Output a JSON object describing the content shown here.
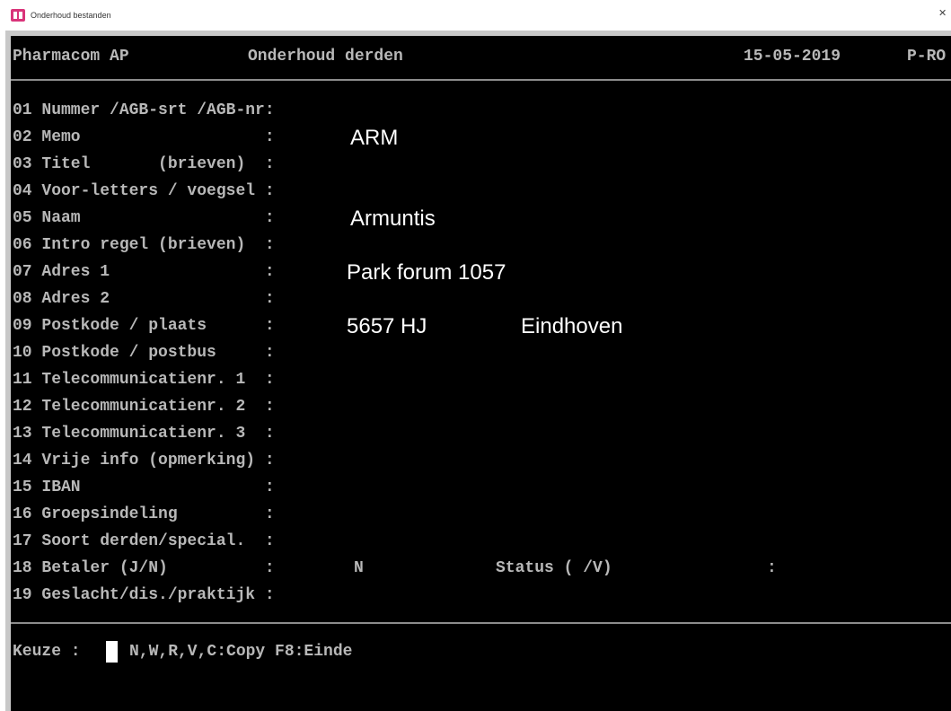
{
  "window": {
    "title": "Onderhoud bestanden",
    "close_symbol": "✕"
  },
  "header": {
    "app": "Pharmacom AP",
    "screen": "Onderhoud derden",
    "date": "15-05-2019",
    "code": "P-RO"
  },
  "fields": [
    {
      "label": "01 Nummer /AGB-srt /AGB-nr:",
      "value": ""
    },
    {
      "label": "02 Memo                   :",
      "value": "ARM"
    },
    {
      "label": "03 Titel       (brieven)  :",
      "value": ""
    },
    {
      "label": "04 Voor-letters / voegsel :",
      "value": ""
    },
    {
      "label": "05 Naam                   :",
      "value": "Armuntis"
    },
    {
      "label": "06 Intro regel (brieven)  :",
      "value": ""
    },
    {
      "label": "07 Adres 1                :",
      "value": "Park forum 1057"
    },
    {
      "label": "08 Adres 2                :",
      "value": ""
    },
    {
      "label": "09 Postkode / plaats      :",
      "value": "5657 HJ",
      "value2": "Eindhoven"
    },
    {
      "label": "10 Postkode / postbus     :",
      "value": ""
    },
    {
      "label": "11 Telecommunicatienr. 1  :",
      "value": ""
    },
    {
      "label": "12 Telecommunicatienr. 2  :",
      "value": ""
    },
    {
      "label": "13 Telecommunicatienr. 3  :",
      "value": ""
    },
    {
      "label": "14 Vrije info (opmerking) :",
      "value": ""
    },
    {
      "label": "15 IBAN                   :",
      "value": ""
    },
    {
      "label": "16 Groepsindeling         :",
      "value": ""
    },
    {
      "label": "17 Soort derden/special.  :",
      "value": ""
    },
    {
      "label": "18 Betaler (J/N)          :",
      "value": "N",
      "status_label": "Status ( /V)",
      "status_sep": ":"
    },
    {
      "label": "19 Geslacht/dis./praktijk :",
      "value": ""
    }
  ],
  "command": {
    "prompt": "Keuze :",
    "options": "N,W,R,V,C:Copy F8:Einde"
  }
}
